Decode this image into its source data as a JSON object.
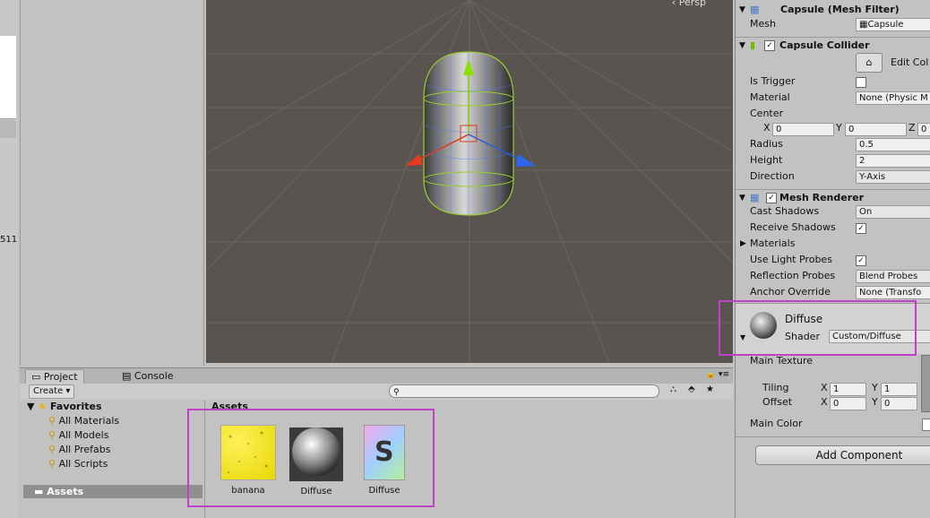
{
  "left_strip": {
    "number": "511"
  },
  "scene": {
    "view_label": "‹ Persp"
  },
  "project": {
    "tabs": [
      {
        "label": "Project"
      },
      {
        "label": "Console"
      }
    ],
    "create_label": "Create",
    "favorites_label": "Favorites",
    "favorites": [
      "All Materials",
      "All Models",
      "All Prefabs",
      "All Scripts"
    ],
    "assets_folder": "Assets",
    "assets_header": "Assets",
    "assets": [
      {
        "name": "banana",
        "icon": "texture-icon"
      },
      {
        "name": "Diffuse",
        "icon": "material-icon"
      },
      {
        "name": "Diffuse",
        "icon": "shader-icon"
      }
    ]
  },
  "inspector": {
    "mesh_filter": {
      "title": "Capsule (Mesh Filter)",
      "mesh_label": "Mesh",
      "mesh_value": "Capsule"
    },
    "capsule_collider": {
      "title": "Capsule Collider",
      "edit_label": "Edit Col",
      "is_trigger_label": "Is Trigger",
      "material_label": "Material",
      "material_value": "None (Physic M",
      "center_label": "Center",
      "x_label": "X",
      "x_value": "0",
      "y_label": "Y",
      "y_value": "0",
      "z_label": "Z",
      "z_value": "0",
      "radius_label": "Radius",
      "radius_value": "0.5",
      "height_label": "Height",
      "height_value": "2",
      "direction_label": "Direction",
      "direction_value": "Y-Axis"
    },
    "mesh_renderer": {
      "title": "Mesh Renderer",
      "cast_label": "Cast Shadows",
      "cast_value": "On",
      "receive_label": "Receive Shadows",
      "materials_label": "Materials",
      "light_probes_label": "Use Light Probes",
      "reflection_label": "Reflection Probes",
      "reflection_value": "Blend Probes",
      "anchor_label": "Anchor Override",
      "anchor_value": "None (Transfo"
    },
    "material": {
      "name": "Diffuse",
      "shader_label": "Shader",
      "shader_value": "Custom/Diffuse",
      "main_texture_label": "Main Texture",
      "tiling_label": "Tiling",
      "tiling_x": "1",
      "tiling_y": "1",
      "offset_label": "Offset",
      "offset_x": "0",
      "offset_y": "0",
      "main_color_label": "Main Color"
    },
    "add_component_label": "Add Component"
  },
  "colors": {
    "highlight": "#c040c8",
    "scene_bg": "#5a5450",
    "panel": "#c2c2c2"
  }
}
